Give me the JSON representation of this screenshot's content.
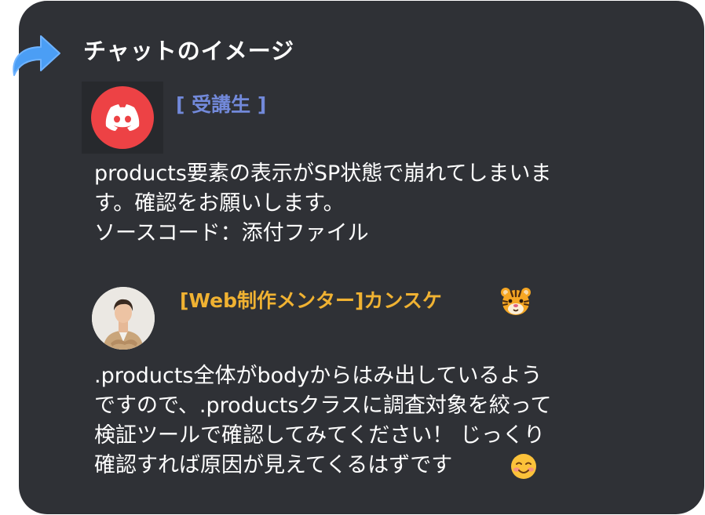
{
  "header": {
    "title": "チャットのイメージ",
    "arrow_icon": "curved-arrow-right-icon"
  },
  "messages": [
    {
      "author": "[ 受講生 ]",
      "author_color": "#7289da",
      "avatar_icon": "discord-logo-icon",
      "avatar_color": "#ed4245",
      "text": "products要素の表示がSP状態で崩れてしまいま\nす。確認をお願いします。\nソースコード：添付ファイル"
    },
    {
      "author": "[Web制作メンター]カンスケ",
      "author_color": "#f0b232",
      "avatar_icon": "user-photo-avatar",
      "author_emoji": "tiger-face-emoji",
      "text": ".products全体がbodyからはみ出しているよう\nですので、.productsクラスに調査対象を絞って\n検証ツールで確認してみてください！ じっくり\n確認すれば原因が見えてくるはずです",
      "trailing_emoji": "smiling-face-emoji"
    }
  ],
  "colors": {
    "background": "#2f3136",
    "text": "#ffffff",
    "arrow": "#4b9ef5"
  }
}
